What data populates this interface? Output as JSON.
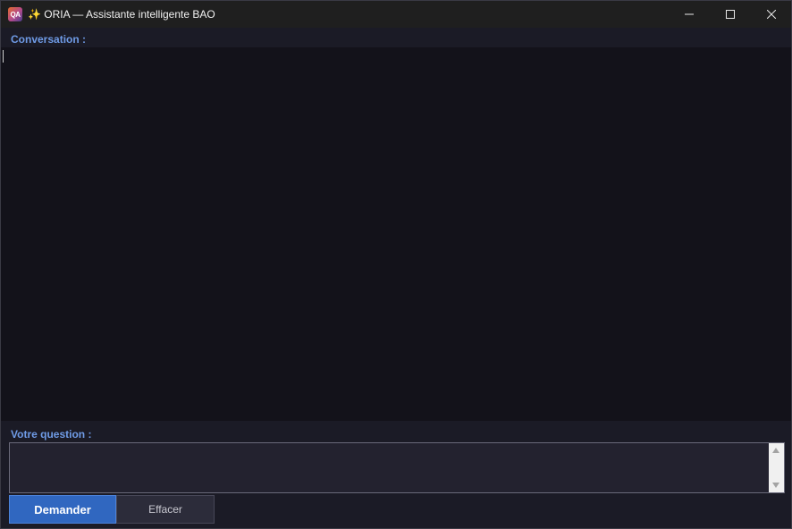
{
  "window": {
    "icon_text": "QA",
    "title": "✨ ORIA — Assistante intelligente BAO"
  },
  "conversation": {
    "label": "Conversation :"
  },
  "question": {
    "label": "Votre question :",
    "value": "",
    "placeholder": ""
  },
  "buttons": {
    "ask_label": "Demander",
    "clear_label": "Effacer"
  },
  "colors": {
    "accent": "#3067c0",
    "label": "#6f9be6",
    "background": "#1b1b26",
    "conversation_bg": "#13121a"
  },
  "icons": {
    "app": "app-logo-icon",
    "minimize": "minimize-icon",
    "maximize": "maximize-icon",
    "close": "close-icon"
  }
}
